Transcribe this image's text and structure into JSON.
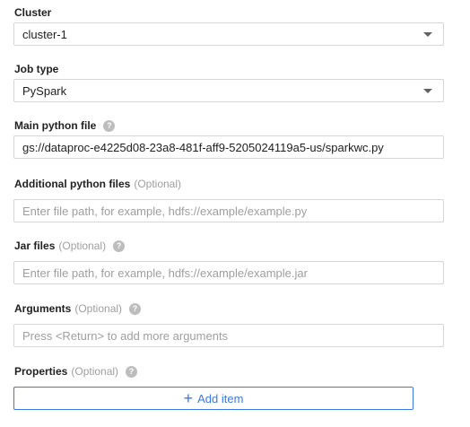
{
  "cluster": {
    "label": "Cluster",
    "value": "cluster-1"
  },
  "job_type": {
    "label": "Job type",
    "value": "PySpark"
  },
  "main_python_file": {
    "label": "Main python file",
    "help_icon": "help-icon",
    "value": "gs://dataproc-e4225d08-23a8-481f-aff9-5205024119a5-us/sparkwc.py"
  },
  "additional_python_files": {
    "label": "Additional python files",
    "optional": "(Optional)",
    "placeholder": "Enter file path, for example, hdfs://example/example.py"
  },
  "jar_files": {
    "label": "Jar files",
    "optional": "(Optional)",
    "help_icon": "help-icon",
    "placeholder": "Enter file path, for example, hdfs://example/example.jar"
  },
  "arguments": {
    "label": "Arguments",
    "optional": "(Optional)",
    "help_icon": "help-icon",
    "placeholder": "Press <Return> to add more arguments"
  },
  "properties": {
    "label": "Properties",
    "optional": "(Optional)",
    "help_icon": "help-icon",
    "add_item_label": "Add item",
    "add_icon_glyph": "+"
  },
  "help_glyph": "?",
  "colors": {
    "accent": "#3b78e7",
    "border": "#d6d6d6",
    "optional_text": "#9e9e9e"
  }
}
